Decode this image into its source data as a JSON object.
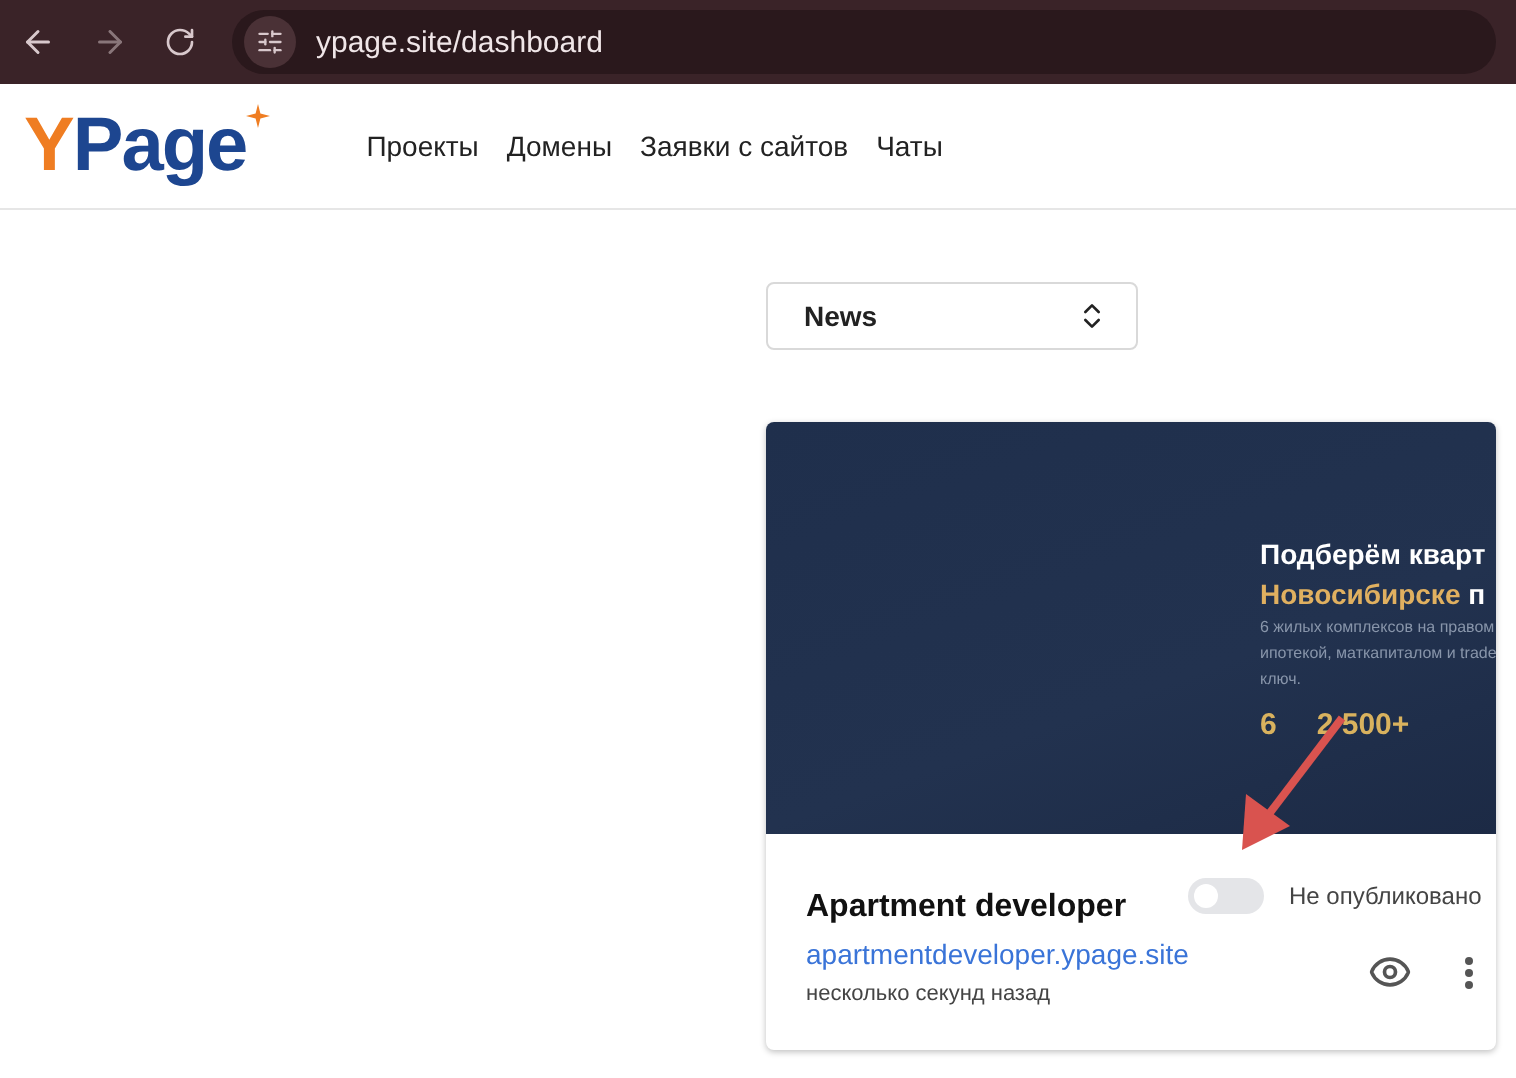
{
  "browser": {
    "url": "ypage.site/dashboard"
  },
  "logo": {
    "accent": "Y",
    "rest": "Page"
  },
  "nav": [
    {
      "label": "Проекты"
    },
    {
      "label": "Домены"
    },
    {
      "label": "Заявки с сайтов"
    },
    {
      "label": "Чаты"
    }
  ],
  "filter": {
    "value": "News"
  },
  "card": {
    "preview": {
      "headline_1": "Подберём кварт",
      "headline_2": "Новосибирске",
      "headline_2_rest": "п",
      "text_lines": [
        "6 жилых комплексов на правом",
        "ипотекой, маткапиталом и trade",
        "ключ."
      ],
      "stats": [
        {
          "value": "6"
        },
        {
          "value": "2 500+"
        }
      ]
    },
    "title": "Apartment developer",
    "link": "apartmentdeveloper.ypage.site",
    "time": "несколько секунд назад",
    "published": false,
    "status": "Не опубликовано"
  }
}
